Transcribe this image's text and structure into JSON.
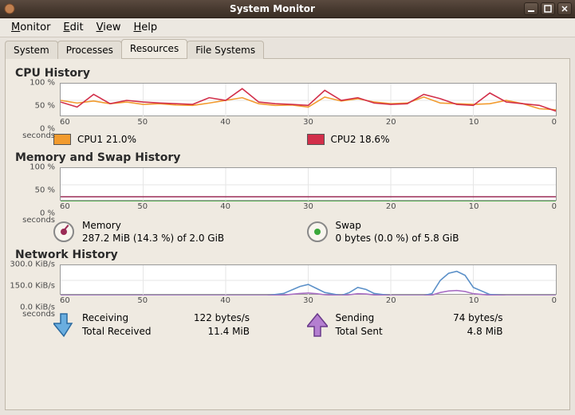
{
  "window": {
    "title": "System Monitor"
  },
  "menu": {
    "monitor": "Monitor",
    "edit": "Edit",
    "view": "View",
    "help": "Help"
  },
  "tabs": {
    "system": "System",
    "processes": "Processes",
    "resources": "Resources",
    "filesystems": "File Systems"
  },
  "cpu": {
    "title": "CPU History",
    "y": {
      "100": "100 %",
      "50": "50 %",
      "0": "0 %"
    },
    "x": {
      "60": "60",
      "50": "50",
      "40": "40",
      "30": "30",
      "20": "20",
      "10": "10",
      "0": "0",
      "unit": "seconds"
    },
    "cpu1_label": "CPU1 21.0%",
    "cpu2_label": "CPU2 18.6%",
    "cpu1_color": "#f29b2e",
    "cpu2_color": "#d22f4a"
  },
  "mem": {
    "title": "Memory and Swap History",
    "y": {
      "100": "100 %",
      "50": "50 %",
      "0": "0 %"
    },
    "x": {
      "60": "60",
      "50": "50",
      "40": "40",
      "30": "30",
      "20": "20",
      "10": "10",
      "0": "0",
      "unit": "seconds"
    },
    "memory_head": "Memory",
    "memory_detail": "287.2 MiB (14.3 %) of 2.0 GiB",
    "swap_head": "Swap",
    "swap_detail": "0 bytes (0.0 %) of 5.8 GiB",
    "mem_color": "#9b2c56",
    "swap_color": "#3aa83a"
  },
  "net": {
    "title": "Network History",
    "y": {
      "300": "300.0 KiB/s",
      "150": "150.0 KiB/s",
      "0": "0.0 KiB/s"
    },
    "x": {
      "60": "60",
      "50": "50",
      "40": "40",
      "30": "30",
      "20": "20",
      "10": "10",
      "0": "0",
      "unit": "seconds"
    },
    "recv_head": "Receiving",
    "recv_rate": "122 bytes/s",
    "recv_total_head": "Total Received",
    "recv_total": "11.4 MiB",
    "send_head": "Sending",
    "send_rate": "74 bytes/s",
    "send_total_head": "Total Sent",
    "send_total": "4.8 MiB",
    "recv_color": "#5b90c8",
    "send_color": "#a96fc4"
  },
  "chart_data": [
    {
      "type": "line",
      "title": "CPU History",
      "xlabel": "seconds",
      "ylabel": "%",
      "xlim": [
        60,
        0
      ],
      "ylim": [
        0,
        100
      ],
      "x": [
        60,
        58,
        56,
        54,
        52,
        50,
        48,
        46,
        44,
        42,
        40,
        38,
        36,
        34,
        32,
        30,
        28,
        26,
        24,
        22,
        20,
        18,
        16,
        14,
        12,
        10,
        8,
        6,
        4,
        2,
        0
      ],
      "series": [
        {
          "name": "CPU1",
          "color": "#f29b2e",
          "values": [
            50,
            42,
            48,
            40,
            45,
            38,
            40,
            36,
            35,
            42,
            50,
            58,
            40,
            35,
            36,
            30,
            60,
            48,
            55,
            45,
            40,
            42,
            60,
            42,
            40,
            38,
            40,
            50,
            40,
            25,
            22
          ]
        },
        {
          "name": "CPU2",
          "color": "#d22f4a",
          "values": [
            45,
            30,
            68,
            40,
            50,
            45,
            42,
            40,
            38,
            58,
            50,
            85,
            45,
            40,
            38,
            35,
            80,
            50,
            58,
            42,
            38,
            40,
            68,
            55,
            38,
            35,
            72,
            45,
            40,
            35,
            18
          ]
        }
      ]
    },
    {
      "type": "line",
      "title": "Memory and Swap History",
      "xlabel": "seconds",
      "ylabel": "%",
      "xlim": [
        60,
        0
      ],
      "ylim": [
        0,
        100
      ],
      "x": [
        60,
        0
      ],
      "series": [
        {
          "name": "Memory",
          "color": "#9b2c56",
          "values": [
            14.3,
            14.3
          ]
        },
        {
          "name": "Swap",
          "color": "#3aa83a",
          "values": [
            0,
            0
          ]
        }
      ]
    },
    {
      "type": "line",
      "title": "Network History",
      "xlabel": "seconds",
      "ylabel": "KiB/s",
      "xlim": [
        60,
        0
      ],
      "ylim": [
        0,
        300
      ],
      "x": [
        60,
        55,
        50,
        45,
        40,
        35,
        33,
        31,
        30,
        29,
        28,
        26,
        25,
        24,
        23,
        22,
        20,
        18,
        16,
        15,
        14,
        13,
        12,
        11,
        10,
        8,
        6,
        4,
        2,
        0
      ],
      "series": [
        {
          "name": "Receiving",
          "color": "#5b90c8",
          "values": [
            0,
            0,
            0,
            0,
            0,
            0,
            20,
            90,
            110,
            70,
            30,
            0,
            30,
            80,
            60,
            20,
            0,
            0,
            0,
            20,
            150,
            220,
            240,
            200,
            80,
            10,
            0,
            0,
            0,
            0
          ]
        },
        {
          "name": "Sending",
          "color": "#a96fc4",
          "values": [
            0,
            0,
            0,
            0,
            0,
            0,
            5,
            20,
            25,
            18,
            8,
            0,
            8,
            18,
            15,
            6,
            0,
            0,
            0,
            5,
            30,
            45,
            50,
            40,
            18,
            4,
            0,
            0,
            0,
            0
          ]
        }
      ]
    }
  ]
}
